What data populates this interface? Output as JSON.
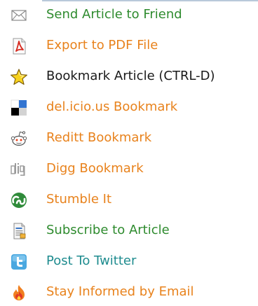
{
  "colors": {
    "green": "#2e8b2e",
    "orange": "#e8821c",
    "black": "#1a1a1a",
    "teal": "#1f8c8f",
    "divider": "#b9c9da"
  },
  "menu": {
    "items": [
      {
        "label": "Send Article to Friend",
        "icon": "envelope-icon",
        "color": "green"
      },
      {
        "label": "Export to PDF File",
        "icon": "pdf-icon",
        "color": "orange"
      },
      {
        "label": "Bookmark Article (CTRL-D)",
        "icon": "star-icon",
        "color": "black"
      },
      {
        "label": "del.icio.us Bookmark",
        "icon": "delicious-icon",
        "color": "orange"
      },
      {
        "label": "Reditt Bookmark",
        "icon": "reddit-icon",
        "color": "orange"
      },
      {
        "label": "Digg Bookmark",
        "icon": "digg-icon",
        "color": "orange"
      },
      {
        "label": "Stumble It",
        "icon": "stumbleupon-icon",
        "color": "orange"
      },
      {
        "label": "Subscribe to Article",
        "icon": "subscribe-icon",
        "color": "green"
      },
      {
        "label": "Post To Twitter",
        "icon": "twitter-icon",
        "color": "teal"
      },
      {
        "label": "Stay Informed by Email",
        "icon": "fire-icon",
        "color": "orange"
      }
    ]
  }
}
